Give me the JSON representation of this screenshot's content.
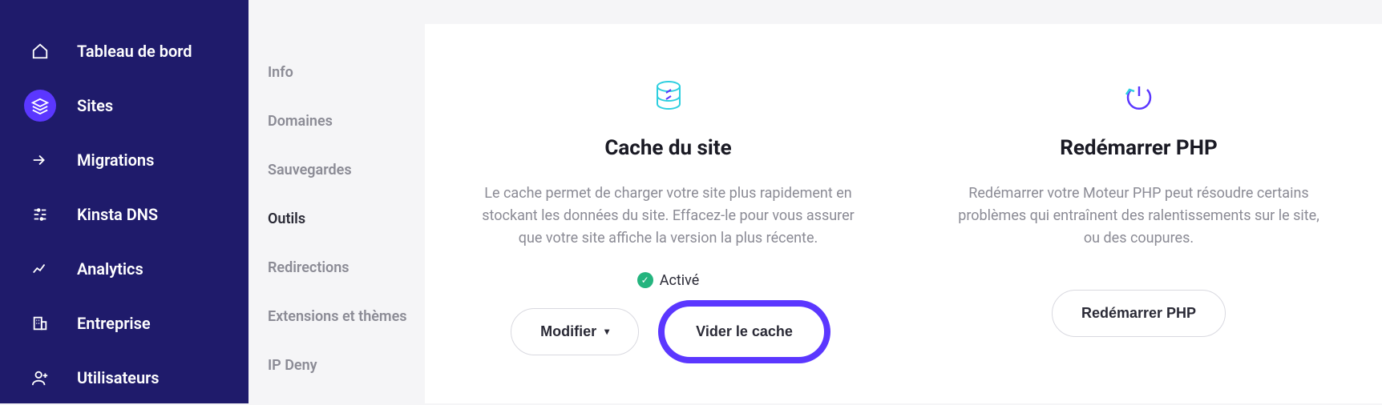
{
  "sidebar": {
    "items": [
      {
        "label": "Tableau de bord"
      },
      {
        "label": "Sites"
      },
      {
        "label": "Migrations"
      },
      {
        "label": "Kinsta DNS"
      },
      {
        "label": "Analytics"
      },
      {
        "label": "Entreprise"
      },
      {
        "label": "Utilisateurs"
      }
    ]
  },
  "submenu": {
    "items": [
      {
        "label": "Info"
      },
      {
        "label": "Domaines"
      },
      {
        "label": "Sauvegardes"
      },
      {
        "label": "Outils"
      },
      {
        "label": "Redirections"
      },
      {
        "label": "Extensions et thèmes"
      },
      {
        "label": "IP Deny"
      }
    ]
  },
  "main": {
    "cache": {
      "title": "Cache du site",
      "desc": "Le cache permet de charger votre site plus rapidement en stockant les données du site. Effacez-le pour vous assurer que votre site affiche la version la plus récente.",
      "status": "Activé",
      "modify": "Modifier",
      "clear": "Vider le cache"
    },
    "php": {
      "title": "Redémarrer PHP",
      "desc": "Redémarrer votre Moteur PHP peut résoudre certains problèmes qui entraînent des ralentissements sur le site, ou des coupures.",
      "restart": "Redémarrer PHP"
    }
  }
}
